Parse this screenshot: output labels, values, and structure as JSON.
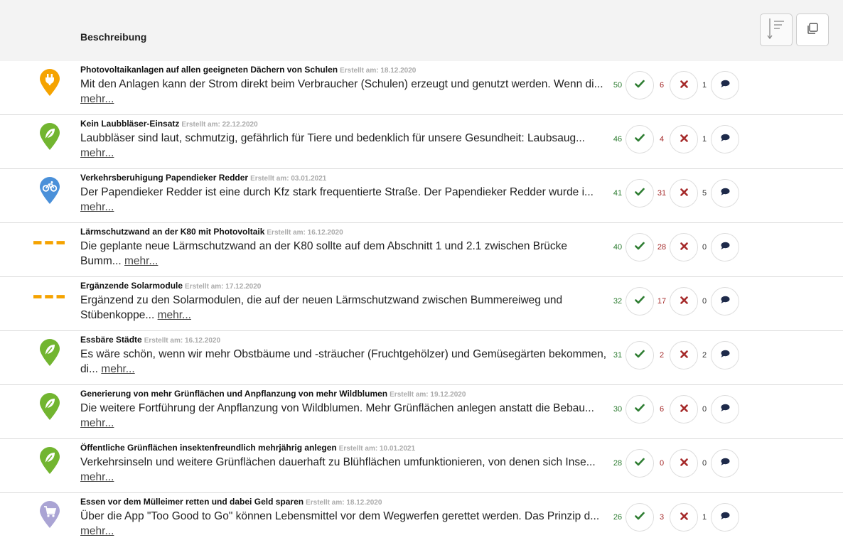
{
  "header": {
    "label": "Beschreibung"
  },
  "toolbar": {
    "sort_icon": "sort-icon",
    "copy_icon": "copy-icon"
  },
  "colors": {
    "orange": "#f5a300",
    "green": "#72b530",
    "blue": "#4a90d9",
    "purple": "#aaa4d4",
    "vote_up": "#2e7d32",
    "vote_down": "#a52a2a"
  },
  "items": [
    {
      "icon": "power-plug-icon",
      "title": "Photovoltaikanlagen auf allen geeigneten Dächern von Schulen",
      "meta": "Erstellt am: 18.12.2020",
      "desc": "Mit den Anlagen kann der Strom direkt beim Verbraucher (Schulen) erzeugt und genutzt werden. Wenn di...",
      "more": "mehr...",
      "up": "50",
      "down": "6",
      "comments": "1"
    },
    {
      "icon": "leaf-icon",
      "title": "Kein Laubbläser-Einsatz",
      "meta": "Erstellt am: 22.12.2020",
      "desc": "Laubbläser sind laut, schmutzig, gefährlich für Tiere und bedenklich für unsere Gesundheit: Laubsaug...",
      "more": "mehr...",
      "up": "46",
      "down": "4",
      "comments": "1"
    },
    {
      "icon": "bicycle-icon",
      "title": "Verkehrsberuhigung Papendieker Redder",
      "meta": "Erstellt am: 03.01.2021",
      "desc": "Der Papendieker Redder ist eine durch Kfz stark frequentierte Straße. Der Papendieker Redder wurde i...",
      "more": "mehr...",
      "up": "41",
      "down": "31",
      "comments": "5"
    },
    {
      "icon": "dashed-line-icon",
      "title": "Lärmschutzwand an der K80 mit Photovoltaik",
      "meta": "Erstellt am: 16.12.2020",
      "desc": "Die geplante neue Lärmschutzwand an der K80 sollte auf dem Abschnitt 1 und 2.1 zwischen Brücke Bumm...",
      "more": "mehr...",
      "up": "40",
      "down": "28",
      "comments": "0"
    },
    {
      "icon": "dashed-line-icon",
      "title": "Ergänzende Solarmodule",
      "meta": "Erstellt am: 17.12.2020",
      "desc": "Ergänzend zu den Solarmodulen, die auf der neuen Lärmschutzwand zwischen Bummereiweg und Stübenkoppe...",
      "more": "mehr...",
      "up": "32",
      "down": "17",
      "comments": "0"
    },
    {
      "icon": "leaf-icon",
      "title": "Essbäre Städte",
      "meta": "Erstellt am: 16.12.2020",
      "desc": "Es wäre schön, wenn wir mehr Obstbäume und -sträucher (Fruchtgehölzer) und Gemüsegärten bekommen, di...",
      "more": "mehr...",
      "up": "31",
      "down": "2",
      "comments": "2"
    },
    {
      "icon": "leaf-icon",
      "title": "Generierung von mehr Grünflächen und Anpflanzung von mehr Wildblumen",
      "meta": "Erstellt am: 19.12.2020",
      "desc": "Die weitere Fortführung der Anpflanzung von Wildblumen. Mehr Grünflächen anlegen anstatt die Bebau...",
      "more": "mehr...",
      "up": "30",
      "down": "6",
      "comments": "0"
    },
    {
      "icon": "leaf-icon",
      "title": "Öffentliche Grünflächen insektenfreundlich mehrjährig anlegen",
      "meta": "Erstellt am: 10.01.2021",
      "desc": "Verkehrsinseln und weitere Grünflächen dauerhaft zu Blühflächen umfunktionieren, von denen sich Inse...",
      "more": "mehr...",
      "up": "28",
      "down": "0",
      "comments": "0"
    },
    {
      "icon": "shopping-cart-icon",
      "title": "Essen vor dem Mülleimer retten und dabei Geld sparen",
      "meta": "Erstellt am: 18.12.2020",
      "desc": "Über die App \"Too Good to Go\" können Lebensmittel vor dem Wegwerfen gerettet werden. Das Prinzip d...",
      "more": "mehr...",
      "up": "26",
      "down": "3",
      "comments": "1"
    }
  ]
}
